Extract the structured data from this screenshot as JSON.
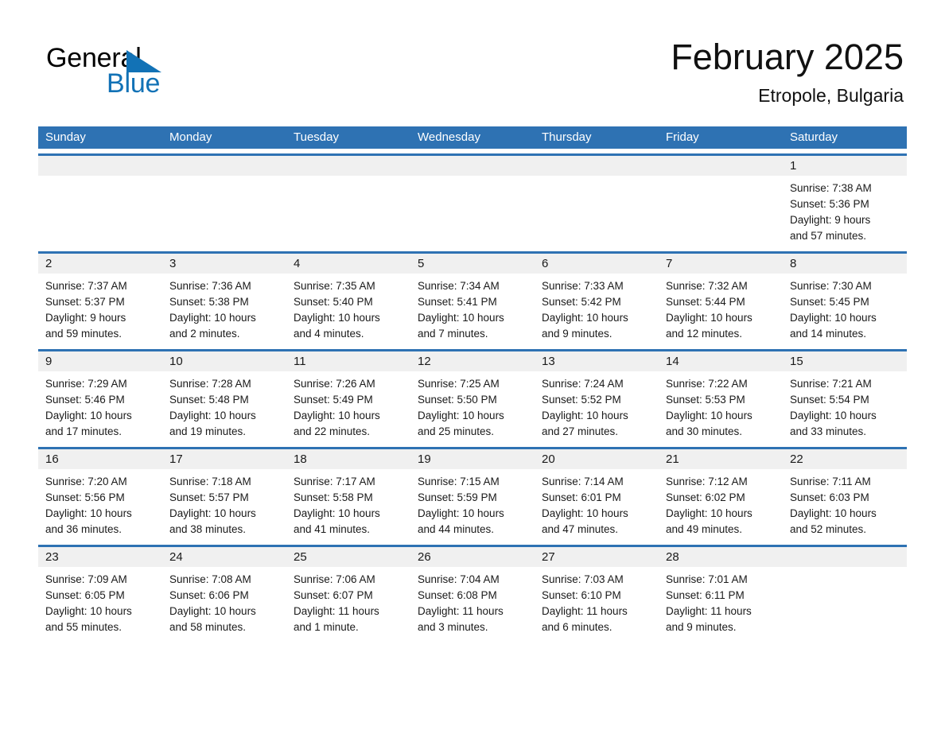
{
  "brand": {
    "name_part1": "General",
    "name_part2": "Blue",
    "triangle_color": "#1272b6"
  },
  "header": {
    "title": "February 2025",
    "subtitle": "Etropole, Bulgaria"
  },
  "theme": {
    "header_blue": "#2e72b3",
    "day_band_gray": "#f0f0f0",
    "text_color": "#1a1a1a",
    "page_background": "#ffffff"
  },
  "weekdays": [
    "Sunday",
    "Monday",
    "Tuesday",
    "Wednesday",
    "Thursday",
    "Friday",
    "Saturday"
  ],
  "weeks": [
    [
      {
        "day": ""
      },
      {
        "day": ""
      },
      {
        "day": ""
      },
      {
        "day": ""
      },
      {
        "day": ""
      },
      {
        "day": ""
      },
      {
        "day": "1",
        "sunrise": "Sunrise: 7:38 AM",
        "sunset": "Sunset: 5:36 PM",
        "daylight1": "Daylight: 9 hours",
        "daylight2": "and 57 minutes."
      }
    ],
    [
      {
        "day": "2",
        "sunrise": "Sunrise: 7:37 AM",
        "sunset": "Sunset: 5:37 PM",
        "daylight1": "Daylight: 9 hours",
        "daylight2": "and 59 minutes."
      },
      {
        "day": "3",
        "sunrise": "Sunrise: 7:36 AM",
        "sunset": "Sunset: 5:38 PM",
        "daylight1": "Daylight: 10 hours",
        "daylight2": "and 2 minutes."
      },
      {
        "day": "4",
        "sunrise": "Sunrise: 7:35 AM",
        "sunset": "Sunset: 5:40 PM",
        "daylight1": "Daylight: 10 hours",
        "daylight2": "and 4 minutes."
      },
      {
        "day": "5",
        "sunrise": "Sunrise: 7:34 AM",
        "sunset": "Sunset: 5:41 PM",
        "daylight1": "Daylight: 10 hours",
        "daylight2": "and 7 minutes."
      },
      {
        "day": "6",
        "sunrise": "Sunrise: 7:33 AM",
        "sunset": "Sunset: 5:42 PM",
        "daylight1": "Daylight: 10 hours",
        "daylight2": "and 9 minutes."
      },
      {
        "day": "7",
        "sunrise": "Sunrise: 7:32 AM",
        "sunset": "Sunset: 5:44 PM",
        "daylight1": "Daylight: 10 hours",
        "daylight2": "and 12 minutes."
      },
      {
        "day": "8",
        "sunrise": "Sunrise: 7:30 AM",
        "sunset": "Sunset: 5:45 PM",
        "daylight1": "Daylight: 10 hours",
        "daylight2": "and 14 minutes."
      }
    ],
    [
      {
        "day": "9",
        "sunrise": "Sunrise: 7:29 AM",
        "sunset": "Sunset: 5:46 PM",
        "daylight1": "Daylight: 10 hours",
        "daylight2": "and 17 minutes."
      },
      {
        "day": "10",
        "sunrise": "Sunrise: 7:28 AM",
        "sunset": "Sunset: 5:48 PM",
        "daylight1": "Daylight: 10 hours",
        "daylight2": "and 19 minutes."
      },
      {
        "day": "11",
        "sunrise": "Sunrise: 7:26 AM",
        "sunset": "Sunset: 5:49 PM",
        "daylight1": "Daylight: 10 hours",
        "daylight2": "and 22 minutes."
      },
      {
        "day": "12",
        "sunrise": "Sunrise: 7:25 AM",
        "sunset": "Sunset: 5:50 PM",
        "daylight1": "Daylight: 10 hours",
        "daylight2": "and 25 minutes."
      },
      {
        "day": "13",
        "sunrise": "Sunrise: 7:24 AM",
        "sunset": "Sunset: 5:52 PM",
        "daylight1": "Daylight: 10 hours",
        "daylight2": "and 27 minutes."
      },
      {
        "day": "14",
        "sunrise": "Sunrise: 7:22 AM",
        "sunset": "Sunset: 5:53 PM",
        "daylight1": "Daylight: 10 hours",
        "daylight2": "and 30 minutes."
      },
      {
        "day": "15",
        "sunrise": "Sunrise: 7:21 AM",
        "sunset": "Sunset: 5:54 PM",
        "daylight1": "Daylight: 10 hours",
        "daylight2": "and 33 minutes."
      }
    ],
    [
      {
        "day": "16",
        "sunrise": "Sunrise: 7:20 AM",
        "sunset": "Sunset: 5:56 PM",
        "daylight1": "Daylight: 10 hours",
        "daylight2": "and 36 minutes."
      },
      {
        "day": "17",
        "sunrise": "Sunrise: 7:18 AM",
        "sunset": "Sunset: 5:57 PM",
        "daylight1": "Daylight: 10 hours",
        "daylight2": "and 38 minutes."
      },
      {
        "day": "18",
        "sunrise": "Sunrise: 7:17 AM",
        "sunset": "Sunset: 5:58 PM",
        "daylight1": "Daylight: 10 hours",
        "daylight2": "and 41 minutes."
      },
      {
        "day": "19",
        "sunrise": "Sunrise: 7:15 AM",
        "sunset": "Sunset: 5:59 PM",
        "daylight1": "Daylight: 10 hours",
        "daylight2": "and 44 minutes."
      },
      {
        "day": "20",
        "sunrise": "Sunrise: 7:14 AM",
        "sunset": "Sunset: 6:01 PM",
        "daylight1": "Daylight: 10 hours",
        "daylight2": "and 47 minutes."
      },
      {
        "day": "21",
        "sunrise": "Sunrise: 7:12 AM",
        "sunset": "Sunset: 6:02 PM",
        "daylight1": "Daylight: 10 hours",
        "daylight2": "and 49 minutes."
      },
      {
        "day": "22",
        "sunrise": "Sunrise: 7:11 AM",
        "sunset": "Sunset: 6:03 PM",
        "daylight1": "Daylight: 10 hours",
        "daylight2": "and 52 minutes."
      }
    ],
    [
      {
        "day": "23",
        "sunrise": "Sunrise: 7:09 AM",
        "sunset": "Sunset: 6:05 PM",
        "daylight1": "Daylight: 10 hours",
        "daylight2": "and 55 minutes."
      },
      {
        "day": "24",
        "sunrise": "Sunrise: 7:08 AM",
        "sunset": "Sunset: 6:06 PM",
        "daylight1": "Daylight: 10 hours",
        "daylight2": "and 58 minutes."
      },
      {
        "day": "25",
        "sunrise": "Sunrise: 7:06 AM",
        "sunset": "Sunset: 6:07 PM",
        "daylight1": "Daylight: 11 hours",
        "daylight2": "and 1 minute."
      },
      {
        "day": "26",
        "sunrise": "Sunrise: 7:04 AM",
        "sunset": "Sunset: 6:08 PM",
        "daylight1": "Daylight: 11 hours",
        "daylight2": "and 3 minutes."
      },
      {
        "day": "27",
        "sunrise": "Sunrise: 7:03 AM",
        "sunset": "Sunset: 6:10 PM",
        "daylight1": "Daylight: 11 hours",
        "daylight2": "and 6 minutes."
      },
      {
        "day": "28",
        "sunrise": "Sunrise: 7:01 AM",
        "sunset": "Sunset: 6:11 PM",
        "daylight1": "Daylight: 11 hours",
        "daylight2": "and 9 minutes."
      },
      {
        "day": ""
      }
    ]
  ]
}
